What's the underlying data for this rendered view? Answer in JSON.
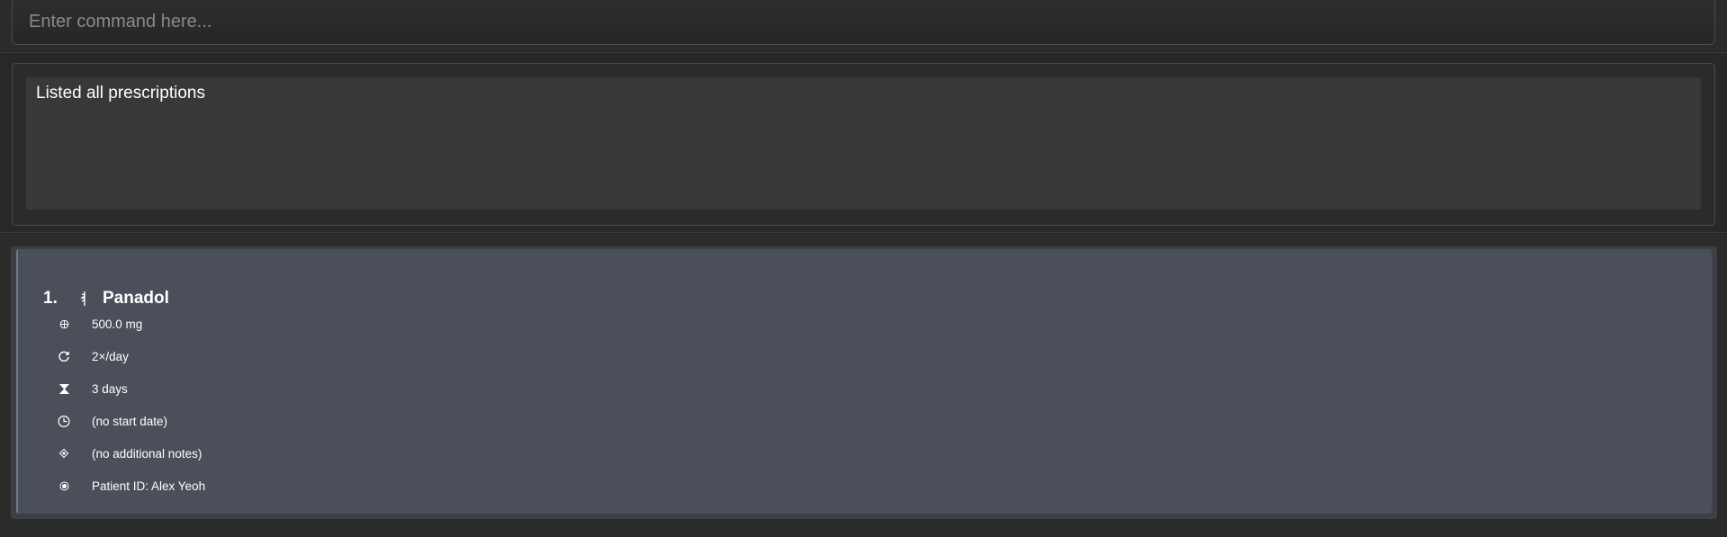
{
  "command": {
    "placeholder": "Enter command here..."
  },
  "result": {
    "message": "Listed all prescriptions"
  },
  "prescriptions": [
    {
      "index": "1.",
      "name": "Panadol",
      "dosage": "500.0 mg",
      "frequency": "2×/day",
      "duration": "3 days",
      "start_date": "(no start date)",
      "notes": "(no additional notes)",
      "patient": "Patient ID: Alex Yeoh"
    }
  ],
  "icons": {
    "name": "rx-symbol-icon",
    "dosage": "crosshair-circle-icon",
    "frequency": "repeat-arrow-icon",
    "duration": "hourglass-icon",
    "start_date": "clock-icon",
    "notes": "diamond-icon",
    "patient": "dot-circle-icon"
  },
  "colors": {
    "background": "#262626",
    "result_box": "#383838",
    "card": "#4a4f5a",
    "card_accent": "#6b7a90"
  }
}
